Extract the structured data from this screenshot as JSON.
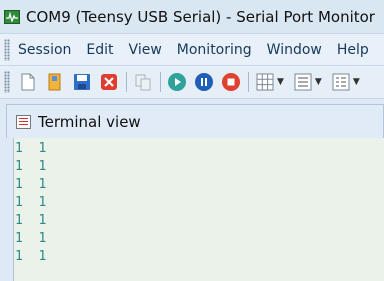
{
  "window": {
    "title": "COM9 (Teensy USB Serial) - Serial Port Monitor"
  },
  "menu": [
    "Session",
    "Edit",
    "View",
    "Monitoring",
    "Window",
    "Help"
  ],
  "toolbar": {
    "buttons": [
      "new-session-icon",
      "open-icon",
      "save-icon",
      "close-session-icon",
      "copy-icon",
      "start-icon",
      "pause-icon",
      "stop-icon",
      "layout-grid-icon",
      "view-list-icon",
      "options-icon"
    ]
  },
  "panel": {
    "title": "Terminal view"
  },
  "terminal": {
    "lines": [
      "1  1",
      "1  1",
      "1  1",
      "1  1",
      "1  1",
      "1  1",
      "1  1"
    ]
  },
  "colors": {
    "accent": "#2e8b3a",
    "terminal_text": "#2a8a8a",
    "terminal_bg": "#ebf2e9"
  }
}
